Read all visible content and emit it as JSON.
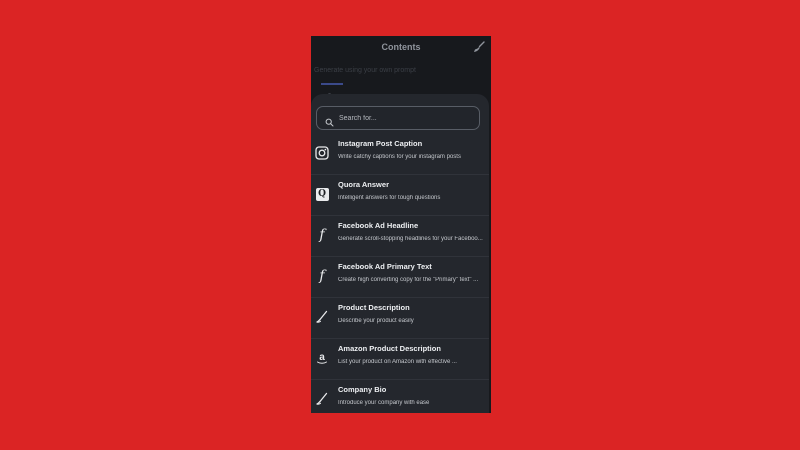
{
  "header": {
    "title": "Contents",
    "brush_icon": "brush-icon"
  },
  "background": {
    "prompt_text": "Generate using your own prompt"
  },
  "search": {
    "placeholder": "Search for...",
    "icon": "search-icon"
  },
  "items": [
    {
      "title": "Instagram Post Caption",
      "description": "Write catchy captions for your instagram posts",
      "icon": "instagram-icon"
    },
    {
      "title": "Quora Answer",
      "description": "Intelligent answers for tough questions",
      "icon": "quora-icon"
    },
    {
      "title": "Facebook Ad Headline",
      "description": "Generate scroll-stopping headlines for your Faceboo...",
      "icon": "facebook-icon"
    },
    {
      "title": "Facebook Ad Primary Text",
      "description": "Create high converting copy for the \"Primary\" text\" ...",
      "icon": "facebook-icon"
    },
    {
      "title": "Product Description",
      "description": "Describe your product easily",
      "icon": "pen-icon"
    },
    {
      "title": "Amazon Product Description",
      "description": "List your product on Amazon with effective ...",
      "icon": "amazon-icon"
    },
    {
      "title": "Company Bio",
      "description": "Introduce your company with ease",
      "icon": "pen-icon"
    }
  ],
  "colors": {
    "background": "#db2424",
    "panel": "#24272d",
    "text": "#eef0f3"
  }
}
